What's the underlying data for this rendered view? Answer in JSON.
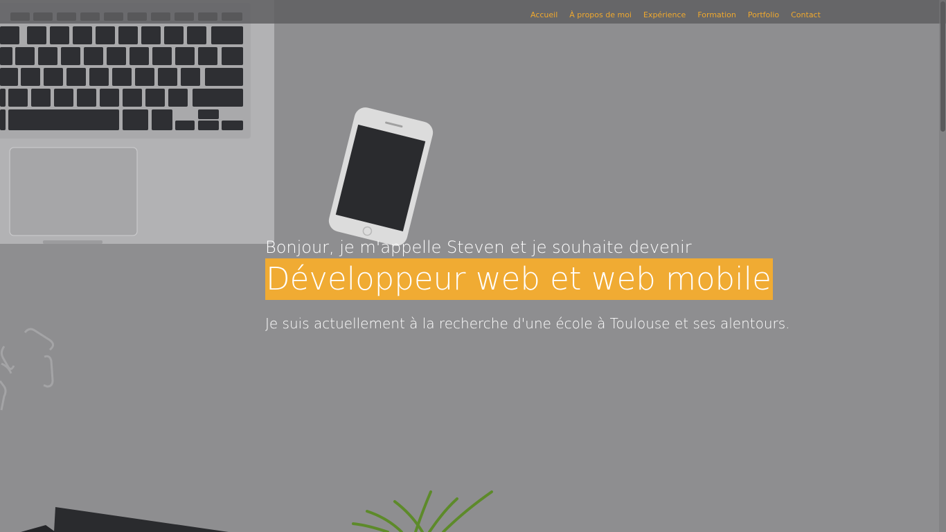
{
  "nav": {
    "items": [
      {
        "label": "Accueil"
      },
      {
        "label": "À propos de moi"
      },
      {
        "label": "Expérience"
      },
      {
        "label": "Formation"
      },
      {
        "label": "Portfolio"
      },
      {
        "label": "Contact"
      }
    ]
  },
  "hero": {
    "intro": "Bonjour, je m'appelle Steven et je souhaite devenir",
    "headline": "Développeur web et web mobile",
    "subline": "Je suis actuellement à la recherche d'une école à Toulouse et ses alentours."
  },
  "colors": {
    "accent": "#f0ab33",
    "nav_text": "#f0a92e",
    "overlay": "#8e8e90"
  }
}
